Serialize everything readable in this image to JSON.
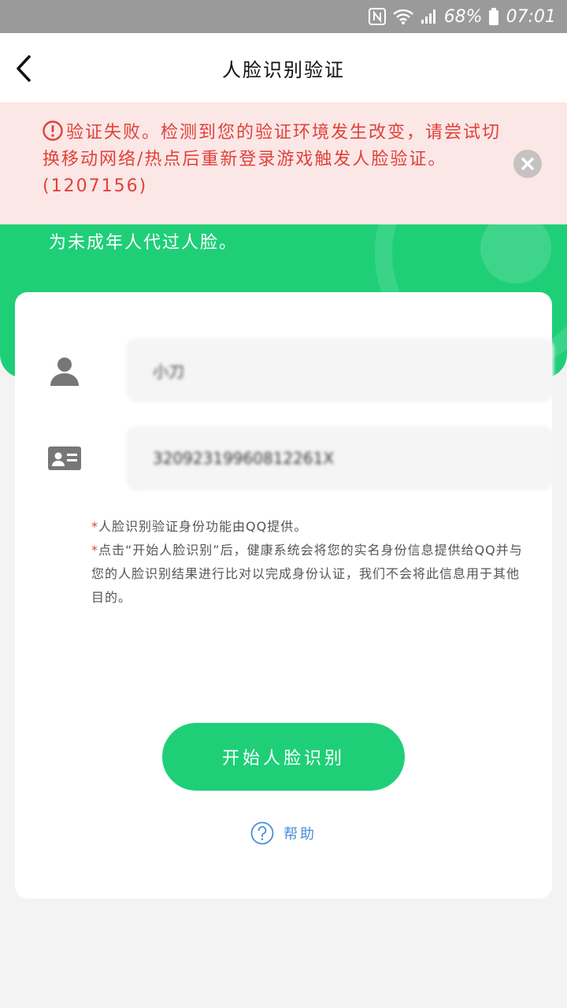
{
  "status_bar": {
    "battery": "68%",
    "time": "07:01"
  },
  "nav": {
    "title": "人脸识别验证"
  },
  "hero": {
    "text": "为未成年人代过人脸。"
  },
  "error": {
    "message": "验证失败。检测到您的验证环境发生改变，请尝试切换移动网络/热点后重新登录游戏触发人脸验证。(1207156)"
  },
  "form": {
    "name_value": "小刀",
    "id_value": "32092319960812261X"
  },
  "notes": [
    "人脸识别验证身份功能由QQ提供。",
    "点击“开始人脸识别”后，健康系统会将您的实名身份信息提供给QQ并与您的人脸识别结果进行比对以完成身份认证，我们不会将此信息用于其他目的。"
  ],
  "actions": {
    "start_label": "开始人脸识别",
    "help_label": "帮助"
  },
  "colors": {
    "brand_green": "#1fcf78",
    "error_red": "#e0423a",
    "link_blue": "#4a8ed8"
  }
}
